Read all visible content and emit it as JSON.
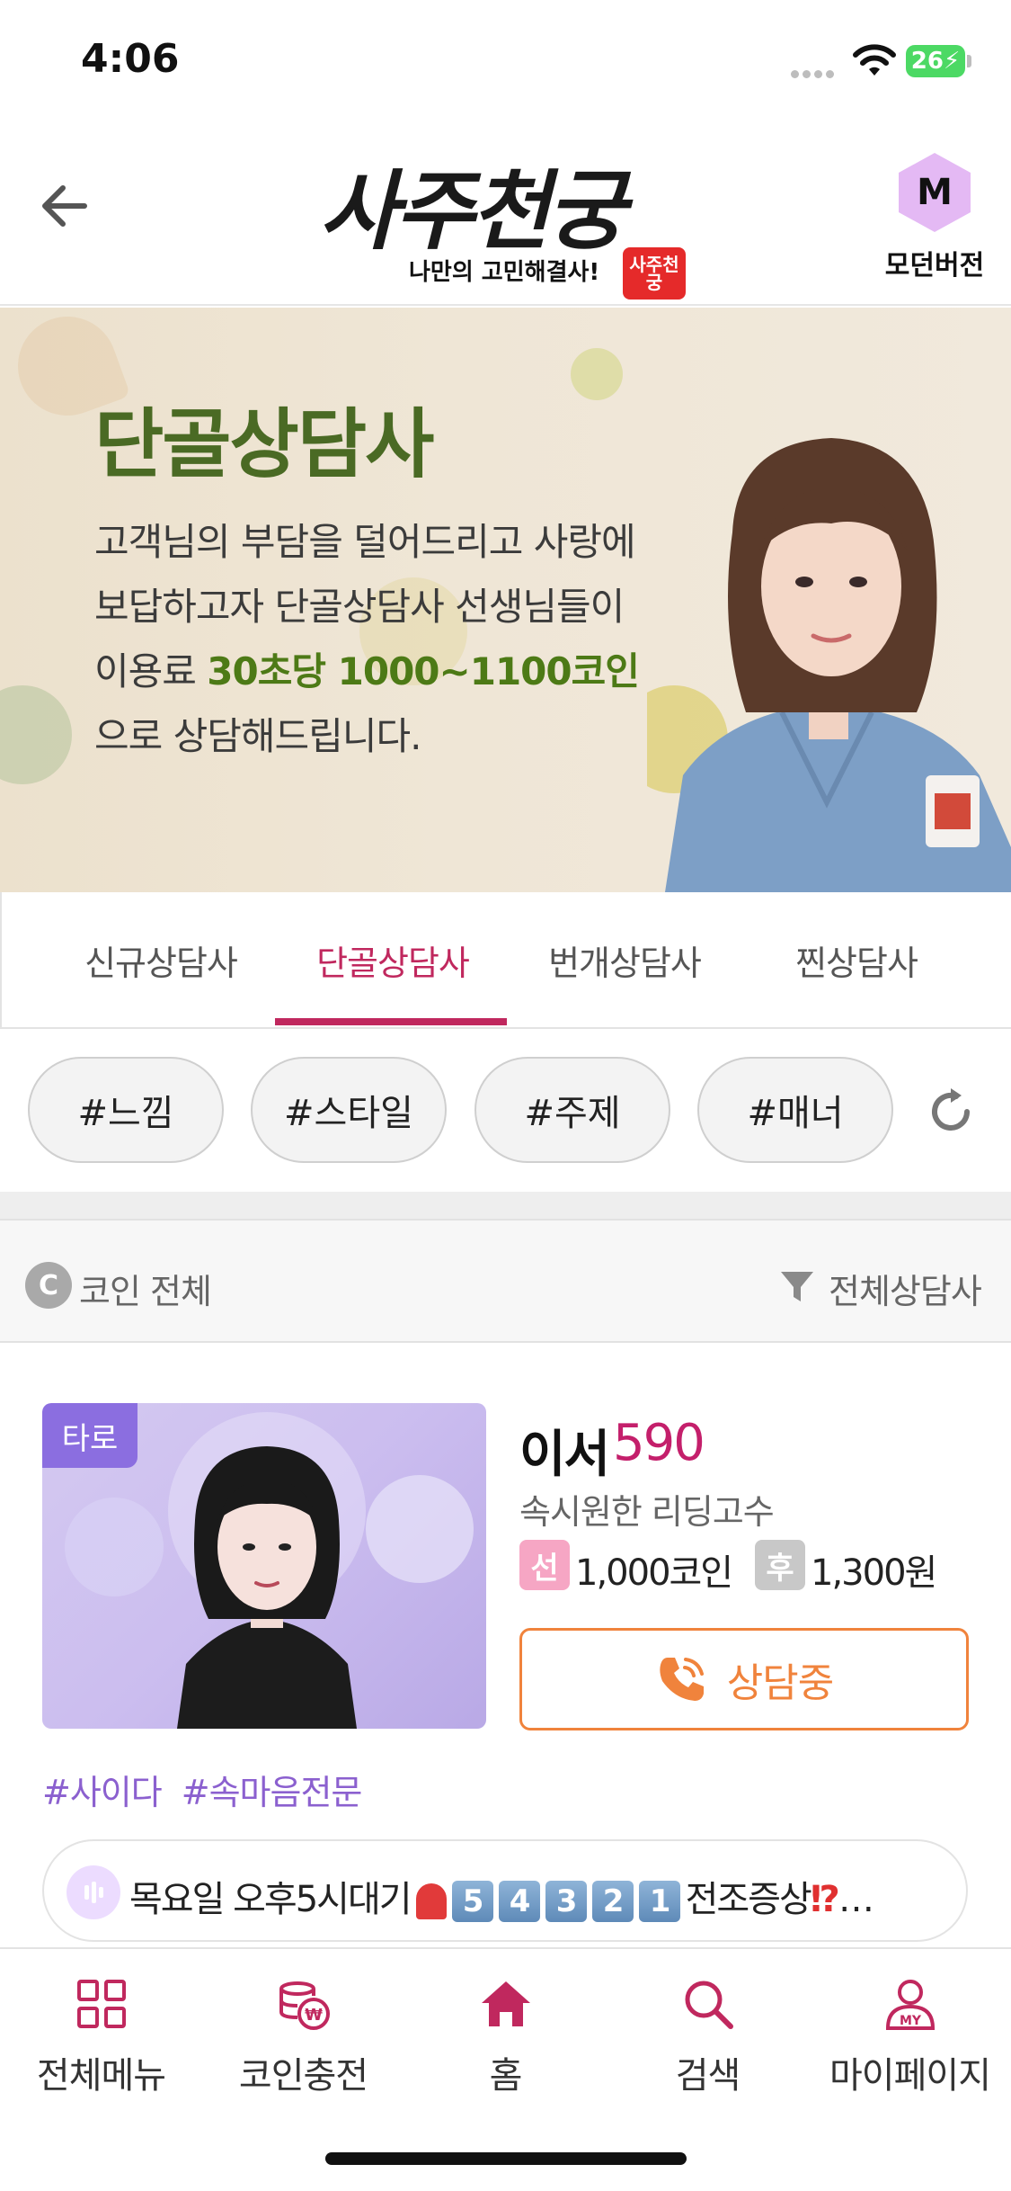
{
  "status_bar": {
    "time": "4:06",
    "battery": "26"
  },
  "header": {
    "logo_title": "사주천궁",
    "logo_subtitle": "나만의 고민해결사!",
    "logo_stamp": "사주천궁",
    "modern_icon_letter": "M",
    "modern_label": "모던버전"
  },
  "banner": {
    "title": "단골상담사",
    "line1": "고객님의 부담을 덜어드리고 사랑에",
    "line2": "보답하고자 단골상담사 선생님들이",
    "line3_prefix": "이용료 ",
    "line3_highlight": "30초당 1000~1100코인",
    "line4": "으로 상담해드립니다."
  },
  "tabs": [
    {
      "label": "신규상담사"
    },
    {
      "label": "단골상담사"
    },
    {
      "label": "번개상담사"
    },
    {
      "label": "찐상담사"
    }
  ],
  "active_tab": "단골상담사",
  "chips": [
    {
      "label": "#느낌"
    },
    {
      "label": "#스타일"
    },
    {
      "label": "#주제"
    },
    {
      "label": "#매너"
    }
  ],
  "filter": {
    "coin_badge": "C",
    "coin_label": "코인 전체",
    "counselor_filter": "전체상담사"
  },
  "counselor": {
    "category_tag": "타로",
    "name": "이서",
    "code": "590",
    "description": "속시원한 리딩고수",
    "pre_label": "선",
    "pre_price": "1,000코인",
    "post_label": "후",
    "post_price": "1,300원",
    "status": "상담중",
    "hashtags": [
      "#사이다",
      "#속마음전문"
    ]
  },
  "notice": {
    "text_prefix": "목요일 오후5시대기",
    "countdown": [
      "5",
      "4",
      "3",
      "2",
      "1"
    ],
    "text_suffix": "전조증상",
    "mark": "⁉",
    "ellipsis": "…"
  },
  "bottom_nav": [
    {
      "label": "전체메뉴",
      "icon": "grid-icon"
    },
    {
      "label": "코인충전",
      "icon": "coin-charge-icon"
    },
    {
      "label": "홈",
      "icon": "home-icon"
    },
    {
      "label": "검색",
      "icon": "search-icon"
    },
    {
      "label": "마이페이지",
      "icon": "my-page-icon"
    }
  ],
  "colors": {
    "accent": "#c0285e",
    "status_orange": "#f0833c",
    "hashtag_purple": "#8b60cf",
    "banner_green": "#4a6a24"
  }
}
